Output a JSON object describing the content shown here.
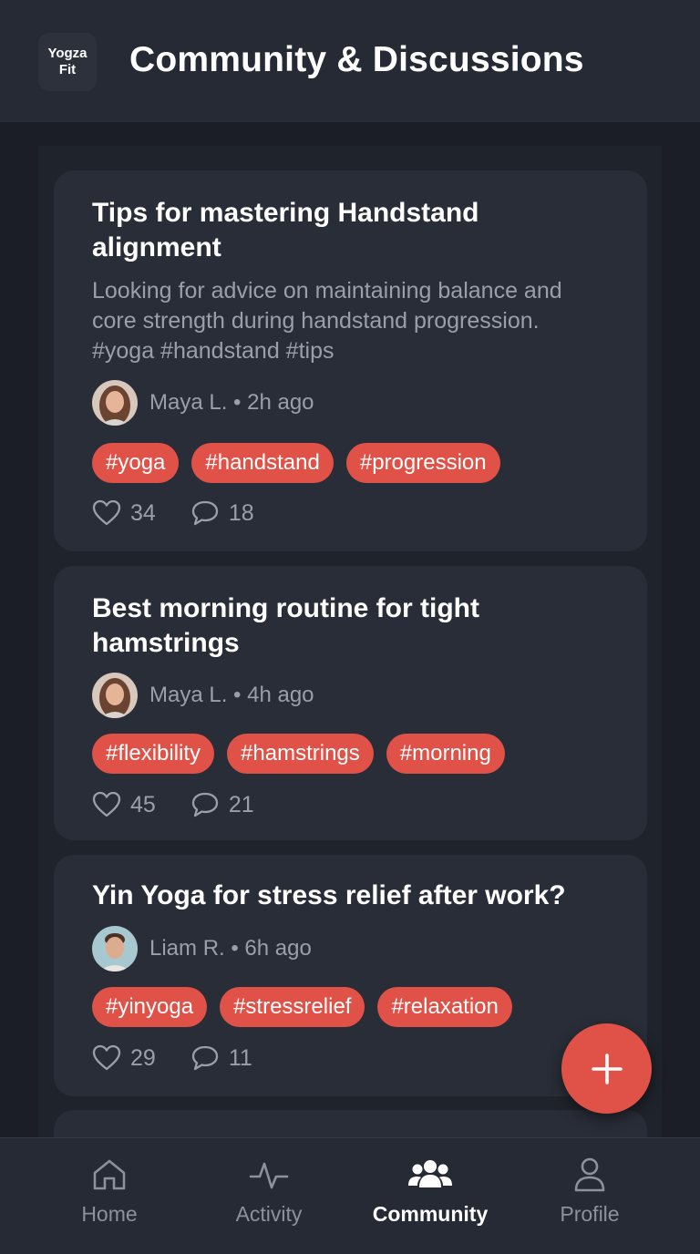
{
  "header": {
    "logo_line1": "Yogza",
    "logo_line2": "Fit",
    "title": "Community & Discussions"
  },
  "posts": [
    {
      "title_line1": "Tips for mastering Handstand",
      "title_line2": "alignment",
      "body_line1": "Looking for advice on maintaining balance and",
      "body_line2": "core strength during handstand progression.",
      "body_line3": "#yoga #handstand #tips",
      "author": "Maya L. • 2h ago",
      "tags": [
        "#yoga",
        "#handstand",
        "#progression"
      ],
      "likes": "34",
      "comments": "18"
    },
    {
      "title_line1": "Best morning routine for tight",
      "title_line2": "hamstrings",
      "author": "Maya L. • 4h ago",
      "tags": [
        "#flexibility",
        "#hamstrings",
        "#morning"
      ],
      "likes": "45",
      "comments": "21"
    },
    {
      "title_line1": "Yin Yoga for stress relief after work?",
      "author": "Liam R. • 6h ago",
      "tags": [
        "#yinyoga",
        "#stressrelief",
        "#relaxation"
      ],
      "likes": "29",
      "comments": "11"
    }
  ],
  "nav": {
    "home": "Home",
    "activity": "Activity",
    "community": "Community",
    "profile": "Profile"
  },
  "colors": {
    "accent": "#e05247",
    "background": "#1b1e26",
    "card": "#292d37"
  },
  "icons": [
    "heart-icon",
    "comment-icon",
    "plus-icon",
    "home-icon",
    "activity-icon",
    "community-icon",
    "profile-icon"
  ]
}
